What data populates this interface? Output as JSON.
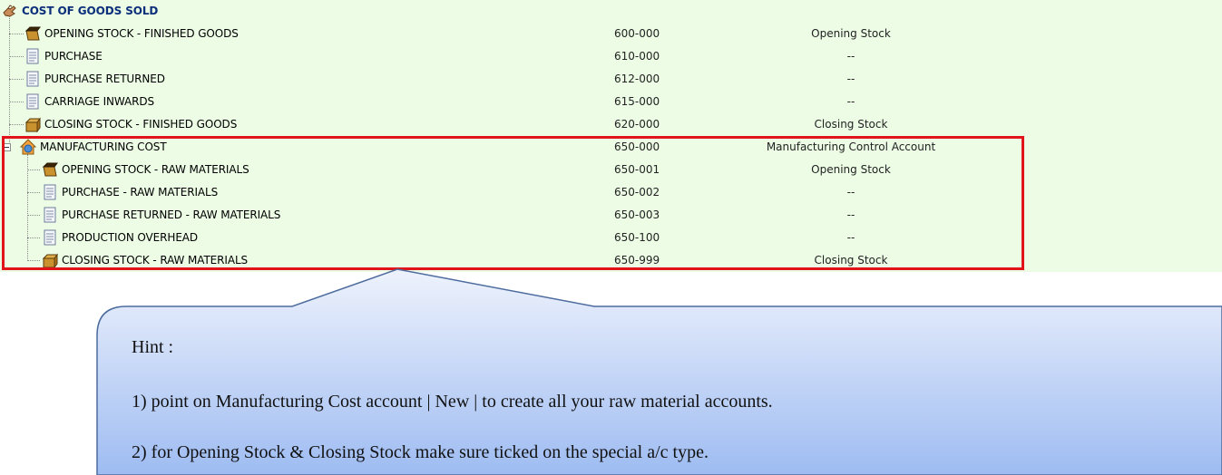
{
  "tree": {
    "root": {
      "label": "COST OF GOODS SOLD",
      "icon": "hand-icon"
    },
    "rows": [
      {
        "label": "OPENING STOCK - FINISHED GOODS",
        "code": "600-000",
        "special": "Opening Stock",
        "icon": "open-box-icon"
      },
      {
        "label": "PURCHASE",
        "code": "610-000",
        "special": "--",
        "icon": "document-icon"
      },
      {
        "label": "PURCHASE RETURNED",
        "code": "612-000",
        "special": "--",
        "icon": "document-icon"
      },
      {
        "label": "CARRIAGE INWARDS",
        "code": "615-000",
        "special": "--",
        "icon": "document-icon"
      },
      {
        "label": "CLOSING STOCK - FINISHED GOODS",
        "code": "620-000",
        "special": "Closing Stock",
        "icon": "closed-box-icon"
      },
      {
        "label": "MANUFACTURING COST",
        "code": "650-000",
        "special": "Manufacturing Control Account",
        "icon": "house-icon",
        "expanded": true
      },
      {
        "label": "OPENING STOCK - RAW MATERIALS",
        "code": "650-001",
        "special": "Opening Stock",
        "icon": "open-box-icon"
      },
      {
        "label": "PURCHASE - RAW MATERIALS",
        "code": "650-002",
        "special": "--",
        "icon": "document-icon"
      },
      {
        "label": "PURCHASE RETURNED - RAW MATERIALS",
        "code": "650-003",
        "special": "--",
        "icon": "document-icon"
      },
      {
        "label": "PRODUCTION OVERHEAD",
        "code": "650-100",
        "special": "--",
        "icon": "document-icon"
      },
      {
        "label": "CLOSING STOCK - RAW MATERIALS",
        "code": "650-999",
        "special": "Closing Stock",
        "icon": "closed-box-icon"
      }
    ]
  },
  "colors": {
    "panel_bg": "#ecfce5",
    "highlight": "#e0141a",
    "callout_top": "#eef2fc",
    "callout_bottom": "#9ebcf2",
    "callout_border": "#4d6c9e"
  },
  "callout": {
    "title": "Hint :",
    "line1": "1) point on Manufacturing Cost account | New | to create all your raw material accounts.",
    "line2": "2) for Opening Stock & Closing Stock make sure ticked on the special a/c type."
  }
}
